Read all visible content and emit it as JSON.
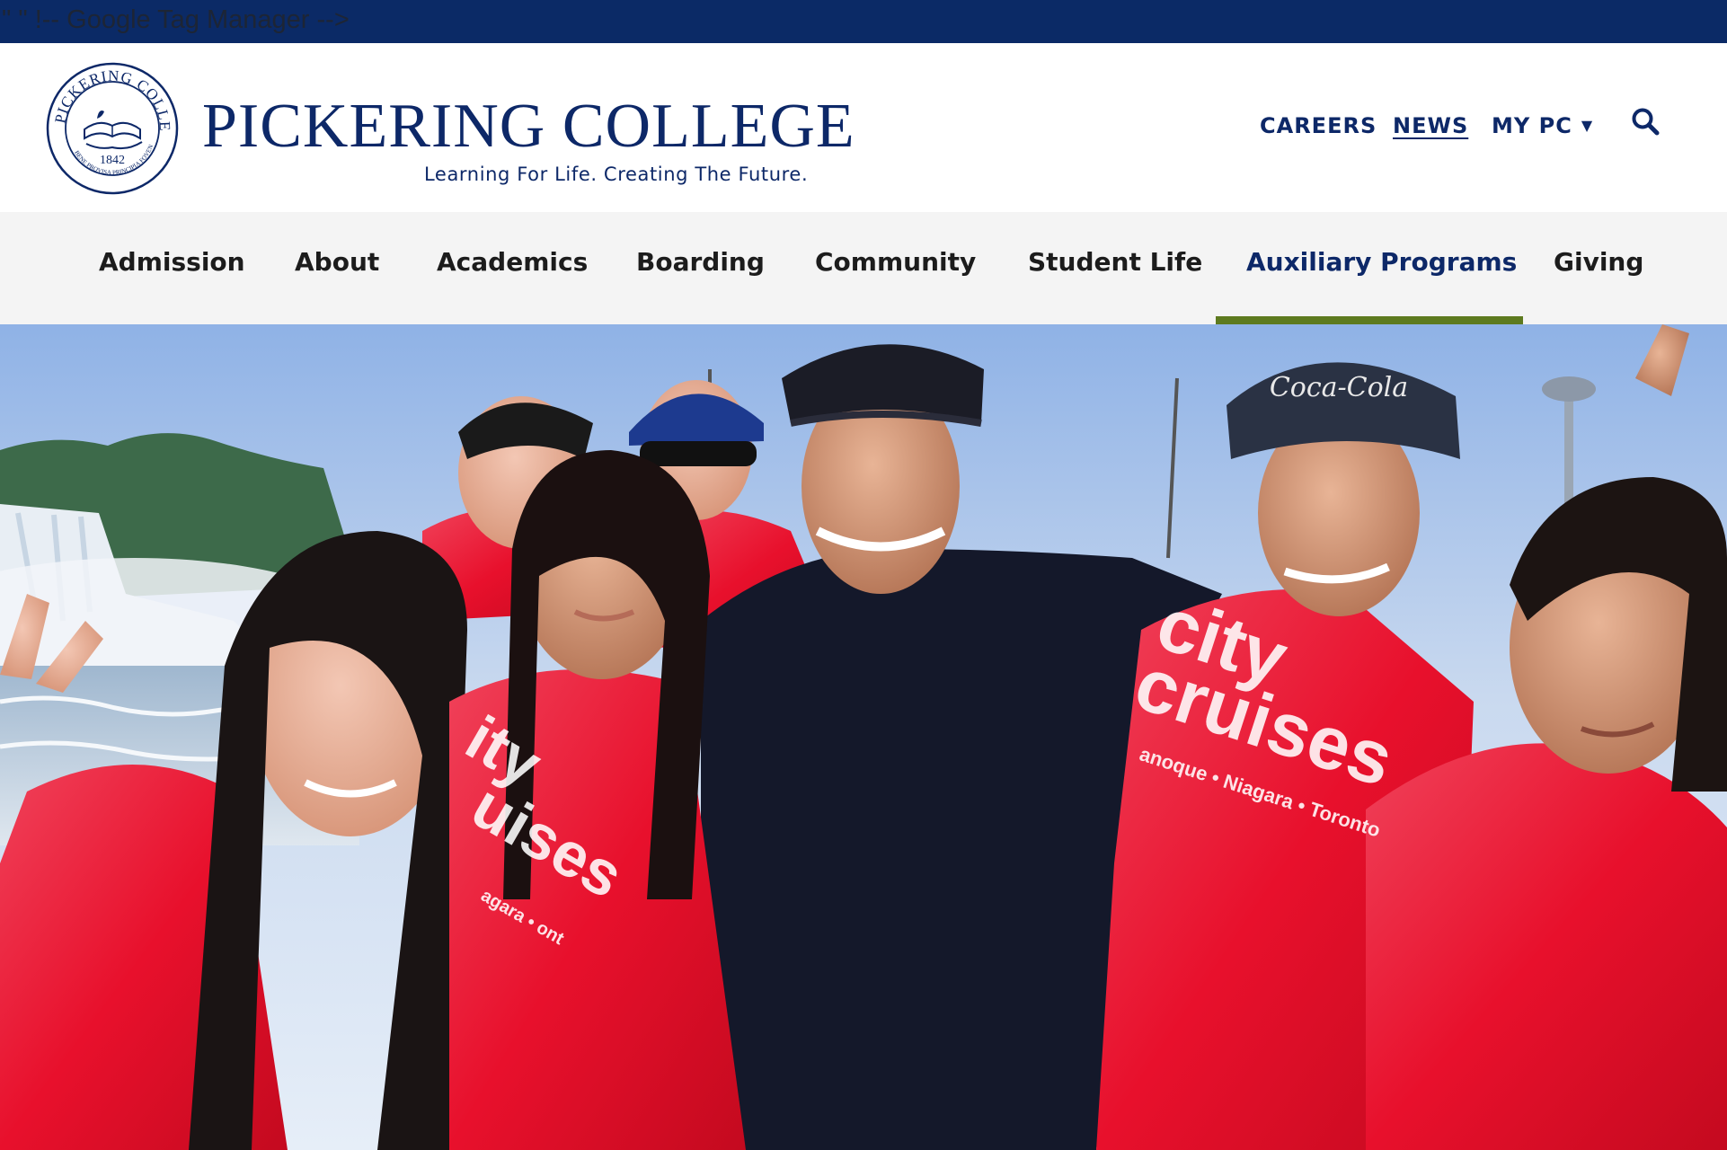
{
  "dev_banner": {
    "text": "\" \" !-- Google Tag Manager -->"
  },
  "brand": {
    "name": "PICKERING COLLEGE",
    "tagline": "Learning For Life. Creating The Future.",
    "seal": {
      "ring_text": "PICKERING COLLEGE",
      "year": "1842",
      "motto": "BENE PROVISA PRINCIPIA FOVENTUR"
    },
    "color": "#0d2868"
  },
  "utility_nav": {
    "careers": "CAREERS",
    "news": "NEWS",
    "my_pc": "MY PC",
    "dropdown_icon": "caret-down-icon",
    "search_icon": "search-icon"
  },
  "main_nav": {
    "items": [
      {
        "label": "Admission"
      },
      {
        "label": "About"
      },
      {
        "label": "Academics"
      },
      {
        "label": "Boarding"
      },
      {
        "label": "Community"
      },
      {
        "label": "Student Life"
      },
      {
        "label": "Auxiliary Programs",
        "active": true
      },
      {
        "label": "Giving"
      }
    ],
    "active_color": "#0d2868",
    "indicator_color": "#5d7a1f"
  },
  "hero": {
    "alt": "Group of students in red rain ponchos at Niagara Falls",
    "poncho_text": [
      "city",
      "cruises",
      "anoque • Niagara • Toronto",
      "ity",
      "uises",
      "agara • ont"
    ],
    "cap_logo_text": "Coca-Cola"
  }
}
